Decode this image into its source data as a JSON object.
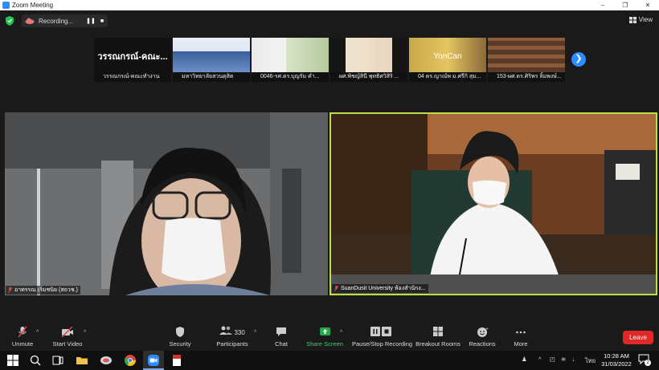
{
  "window": {
    "title": "Zoom Meeting"
  },
  "recording": {
    "label": "Recording..."
  },
  "view": {
    "label": "View"
  },
  "thumbnails": [
    {
      "caption": "วรรณกรณ์-คณะทำงาน",
      "display_text": "วรรณกรณ์-คณะ..."
    },
    {
      "caption": "มหาวิทยาลัยสวนดุสิต"
    },
    {
      "caption": "0046-รศ.ดร.บุญรัม คำ..."
    },
    {
      "caption": "ผศ.พิชญ์สินี พุทธิศวิสิริ ..."
    },
    {
      "caption": "04 ดร.ญาณ์พ ม.ศรีกิ สุม...",
      "display_text": "YonCan"
    },
    {
      "caption": "153-ผศ.ดร.ศิริพร ลิ้มพงษ์..."
    }
  ],
  "participants": {
    "left_name": "อาทรรณ เริ่มชนิย (สถวช.)",
    "right_name": "SuanDusit University ห้องสำนักง..."
  },
  "toolbar": {
    "unmute": "Unmute",
    "start_video": "Start Video",
    "security": "Security",
    "participants": "Participants",
    "participants_count": "330",
    "chat": "Chat",
    "share_screen": "Share Screen",
    "pause_recording": "Pause/Stop Recording",
    "breakout_rooms": "Breakout Rooms",
    "reactions": "Reactions",
    "more": "More",
    "leave": "Leave"
  },
  "taskbar": {
    "language": "ไทย",
    "time": "10:28 AM",
    "date": "31/03/2022",
    "notification_count": "2"
  },
  "colors": {
    "accent": "#2d8cff",
    "active_border": "#b9e04a",
    "leave": "#e02828",
    "share": "#23a94a"
  }
}
